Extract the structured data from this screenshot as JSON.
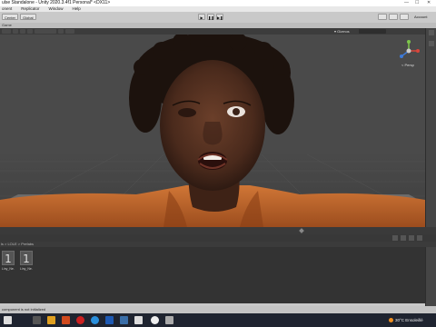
{
  "window": {
    "title": "ulse Standalone - Unity 2020.3.4f1 Personal* <DX11>",
    "controls": [
      "—",
      "☐",
      "✕"
    ]
  },
  "menubar": {
    "items": [
      "onent",
      "Replicator",
      "Window",
      "Help"
    ]
  },
  "toolbar": {
    "center_label": "Center",
    "global_label": "Global",
    "play_icons": [
      "▶",
      "❚❚",
      "▶❚"
    ],
    "account_label": "Account"
  },
  "scene": {
    "tabs": [
      "Game"
    ],
    "persp_dropdown": "▾ Gizmos",
    "gizmo_label": "< Persp"
  },
  "project": {
    "breadcrumb": "ls  >  LOLE  >  Prefabs",
    "assets": [
      {
        "glyph": "1",
        "label": "Liny_Ne..."
      },
      {
        "glyph": "1",
        "label": "Liny_Ne..."
      }
    ]
  },
  "status": {
    "text": "component is not initialized"
  },
  "taskbar": {
    "weather": "30°C  Ensoleillé"
  },
  "colors": {
    "viewport_bg": "#4a4a4a",
    "skin": "#4a2a1c",
    "shirt": "#c46a2e",
    "floor": "#5a5a5a"
  }
}
